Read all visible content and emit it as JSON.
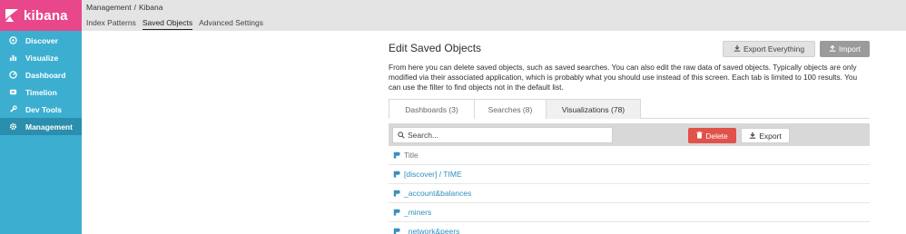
{
  "brand": {
    "name": "kibana"
  },
  "sidebar": {
    "items": [
      {
        "label": "Discover",
        "icon": "compass-icon"
      },
      {
        "label": "Visualize",
        "icon": "bar-chart-icon"
      },
      {
        "label": "Dashboard",
        "icon": "dashboard-icon"
      },
      {
        "label": "Timelion",
        "icon": "timelion-icon"
      },
      {
        "label": "Dev Tools",
        "icon": "wrench-icon"
      },
      {
        "label": "Management",
        "icon": "gear-icon"
      }
    ],
    "active": "Management"
  },
  "breadcrumb": {
    "parent": "Management",
    "separator": "/",
    "current": "Kibana"
  },
  "subnav": {
    "items": [
      "Index Patterns",
      "Saved Objects",
      "Advanced Settings"
    ],
    "active": "Saved Objects"
  },
  "main": {
    "title": "Edit Saved Objects",
    "export_all_label": "Export Everything",
    "import_label": "Import",
    "description": "From here you can delete saved objects, such as saved searches. You can also edit the raw data of saved objects. Typically objects are only modified via their associated application, which is probably what you should use instead of this screen. Each tab is limited to 100 results. You can use the filter to find objects not in the default list."
  },
  "tabs": [
    {
      "label": "Dashboards (3)"
    },
    {
      "label": "Searches (8)"
    },
    {
      "label": "Visualizations (78)"
    }
  ],
  "toolbar": {
    "search_placeholder": "Search...",
    "delete_label": "Delete",
    "export_label": "Export"
  },
  "table": {
    "header": "Title",
    "rows": [
      "[discover] / TIME",
      "_account&balances",
      "_miners",
      "_network&peers"
    ]
  },
  "colors": {
    "brand": "#e8488b",
    "sidebar": "#3cafd1",
    "sidebar_active": "#2a8eac",
    "danger": "#e0524a",
    "link": "#2e8fbf"
  }
}
